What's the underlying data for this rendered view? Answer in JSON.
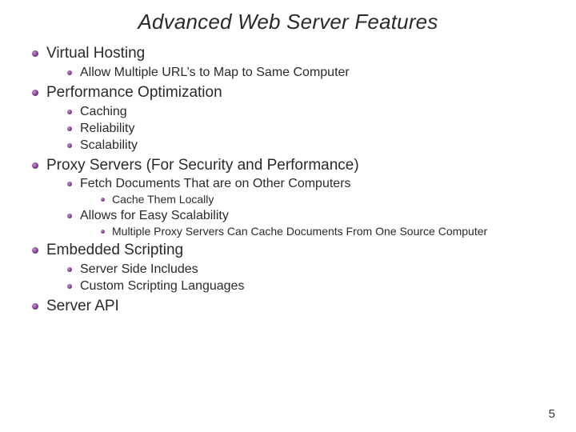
{
  "title": "Advanced Web Server Features",
  "page_number": "5",
  "items": [
    {
      "label": "Virtual Hosting",
      "children": [
        {
          "label": "Allow Multiple URL’s to Map to Same Computer"
        }
      ]
    },
    {
      "label": "Performance Optimization",
      "children": [
        {
          "label": "Caching"
        },
        {
          "label": "Reliability"
        },
        {
          "label": "Scalability"
        }
      ]
    },
    {
      "label": "Proxy Servers (For Security and Performance)",
      "children": [
        {
          "label": "Fetch Documents That are on Other Computers",
          "children": [
            {
              "label": "Cache Them Locally"
            }
          ]
        },
        {
          "label": "Allows for Easy Scalability",
          "children": [
            {
              "label": "Multiple Proxy Servers Can Cache Documents From One Source Computer"
            }
          ]
        }
      ]
    },
    {
      "label": "Embedded Scripting",
      "children": [
        {
          "label": "Server Side Includes"
        },
        {
          "label": "Custom Scripting Languages"
        }
      ]
    },
    {
      "label": "Server API"
    }
  ]
}
